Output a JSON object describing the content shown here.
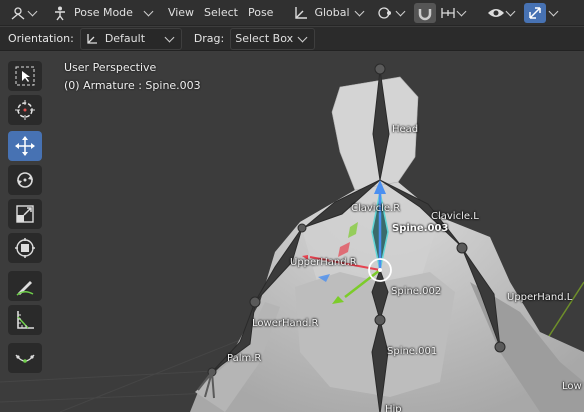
{
  "header": {
    "editor_icon": "armature-pose-icon",
    "mode_icon": "pose-mode-icon",
    "mode_label": "Pose Mode",
    "menus": [
      "View",
      "Select",
      "Pose"
    ],
    "transform_icon": "transform-orientation-icon",
    "orientation_label": "Global",
    "snap_icon": "snap-magnet-icon",
    "visibility_icon": "eye-icon",
    "gizmo_icon": "gizmo-icon",
    "accent": "#4772b3"
  },
  "tool_header": {
    "orientation_label": "Orientation:",
    "orientation_value": "Default",
    "drag_label": "Drag:",
    "drag_value": "Select Box"
  },
  "viewport": {
    "view_name": "User Perspective",
    "object_info": "(0) Armature : Spine.003"
  },
  "tools": [
    {
      "name": "select-box-tool",
      "icon": "cursor-box-icon",
      "active": false
    },
    {
      "name": "cursor-tool",
      "icon": "crosshair-cursor-icon",
      "active": false
    },
    {
      "name": "move-tool",
      "icon": "move-arrows-icon",
      "active": true
    },
    {
      "name": "rotate-tool",
      "icon": "rotate-icon",
      "active": false
    },
    {
      "name": "scale-tool",
      "icon": "scale-icon",
      "active": false
    },
    {
      "name": "transform-tool",
      "icon": "transform-icon",
      "active": false
    },
    {
      "name": "annotate-tool",
      "icon": "annotate-pencil-icon",
      "active": false
    },
    {
      "name": "measure-tool",
      "icon": "measure-icon",
      "active": false
    },
    {
      "name": "pose-relax-tool",
      "icon": "curve-points-icon",
      "active": false
    }
  ],
  "bone_labels": {
    "head": "Head",
    "clavicle_r": "Clavicle.R",
    "clavicle_l": "Clavicle.L",
    "spine_003": "Spine.003",
    "upperhand_r": "UpperHand.R",
    "spine_002": "Spine.002",
    "upperhand_l": "UpperHand.L",
    "lowerhand_r": "LowerHand.R",
    "spine_001": "Spine.001",
    "palm_r": "Palm.R",
    "lowerhand_l": "Low",
    "hips": "Hip"
  }
}
